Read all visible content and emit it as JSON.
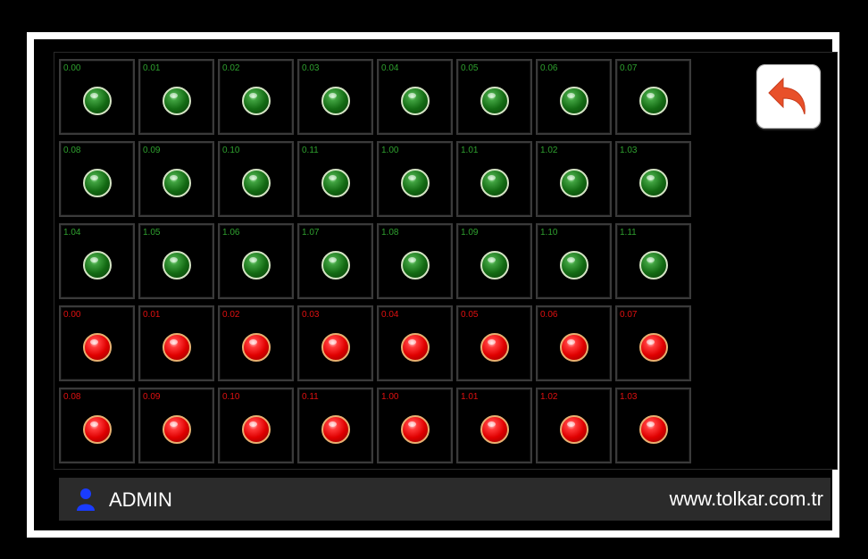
{
  "colors": {
    "on_label": "#2fa02f",
    "off_label": "#e01010",
    "back_arrow": "#e8502a"
  },
  "cells": [
    {
      "label": "0.00",
      "state": "on"
    },
    {
      "label": "0.01",
      "state": "on"
    },
    {
      "label": "0.02",
      "state": "on"
    },
    {
      "label": "0.03",
      "state": "on"
    },
    {
      "label": "0.04",
      "state": "on"
    },
    {
      "label": "0.05",
      "state": "on"
    },
    {
      "label": "0.06",
      "state": "on"
    },
    {
      "label": "0.07",
      "state": "on"
    },
    {
      "label": "0.08",
      "state": "on"
    },
    {
      "label": "0.09",
      "state": "on"
    },
    {
      "label": "0.10",
      "state": "on"
    },
    {
      "label": "0.11",
      "state": "on"
    },
    {
      "label": "1.00",
      "state": "on"
    },
    {
      "label": "1.01",
      "state": "on"
    },
    {
      "label": "1.02",
      "state": "on"
    },
    {
      "label": "1.03",
      "state": "on"
    },
    {
      "label": "1.04",
      "state": "on"
    },
    {
      "label": "1.05",
      "state": "on"
    },
    {
      "label": "1.06",
      "state": "on"
    },
    {
      "label": "1.07",
      "state": "on"
    },
    {
      "label": "1.08",
      "state": "on"
    },
    {
      "label": "1.09",
      "state": "on"
    },
    {
      "label": "1.10",
      "state": "on"
    },
    {
      "label": "1.11",
      "state": "on"
    },
    {
      "label": "0.00",
      "state": "off"
    },
    {
      "label": "0.01",
      "state": "off"
    },
    {
      "label": "0.02",
      "state": "off"
    },
    {
      "label": "0.03",
      "state": "off"
    },
    {
      "label": "0.04",
      "state": "off"
    },
    {
      "label": "0.05",
      "state": "off"
    },
    {
      "label": "0.06",
      "state": "off"
    },
    {
      "label": "0.07",
      "state": "off"
    },
    {
      "label": "0.08",
      "state": "off"
    },
    {
      "label": "0.09",
      "state": "off"
    },
    {
      "label": "0.10",
      "state": "off"
    },
    {
      "label": "0.11",
      "state": "off"
    },
    {
      "label": "1.00",
      "state": "off"
    },
    {
      "label": "1.01",
      "state": "off"
    },
    {
      "label": "1.02",
      "state": "off"
    },
    {
      "label": "1.03",
      "state": "off"
    }
  ],
  "back_button": {
    "icon": "undo-arrow-icon"
  },
  "status_bar": {
    "user_icon": "user-icon",
    "user": "ADMIN",
    "website": "www.tolkar.com.tr"
  }
}
